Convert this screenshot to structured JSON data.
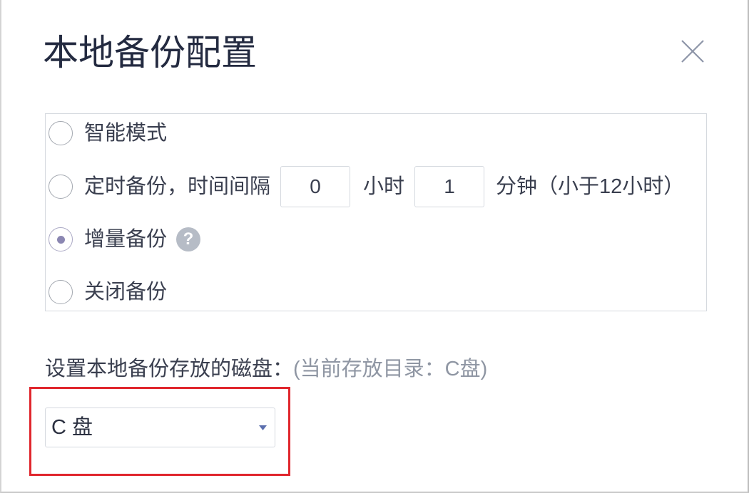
{
  "dialog": {
    "title": "本地备份配置",
    "close_icon": "close-icon"
  },
  "backup_modes": {
    "options": [
      {
        "label": "智能模式",
        "selected": false
      },
      {
        "label": "定时备份，时间间隔",
        "selected": false
      },
      {
        "label": "增量备份",
        "selected": true
      },
      {
        "label": "关闭备份",
        "selected": false
      }
    ],
    "schedule": {
      "hours_value": "0",
      "hours_unit": "小时",
      "minutes_value": "1",
      "minutes_unit": "分钟",
      "limit_note": "（小于12小时）"
    },
    "help": {
      "icon": "question-circle-icon",
      "glyph": "?"
    }
  },
  "disk": {
    "label": "设置本地备份存放的磁盘：",
    "current_note": "(当前存放目录：C盘)",
    "selected_value": "C 盘",
    "dropdown_icon": "caret-down-icon"
  },
  "colors": {
    "radio_checked": "#8b87b2",
    "highlight_border": "#e0262d",
    "title_text": "#232a40",
    "muted_text": "#8f96a3"
  }
}
